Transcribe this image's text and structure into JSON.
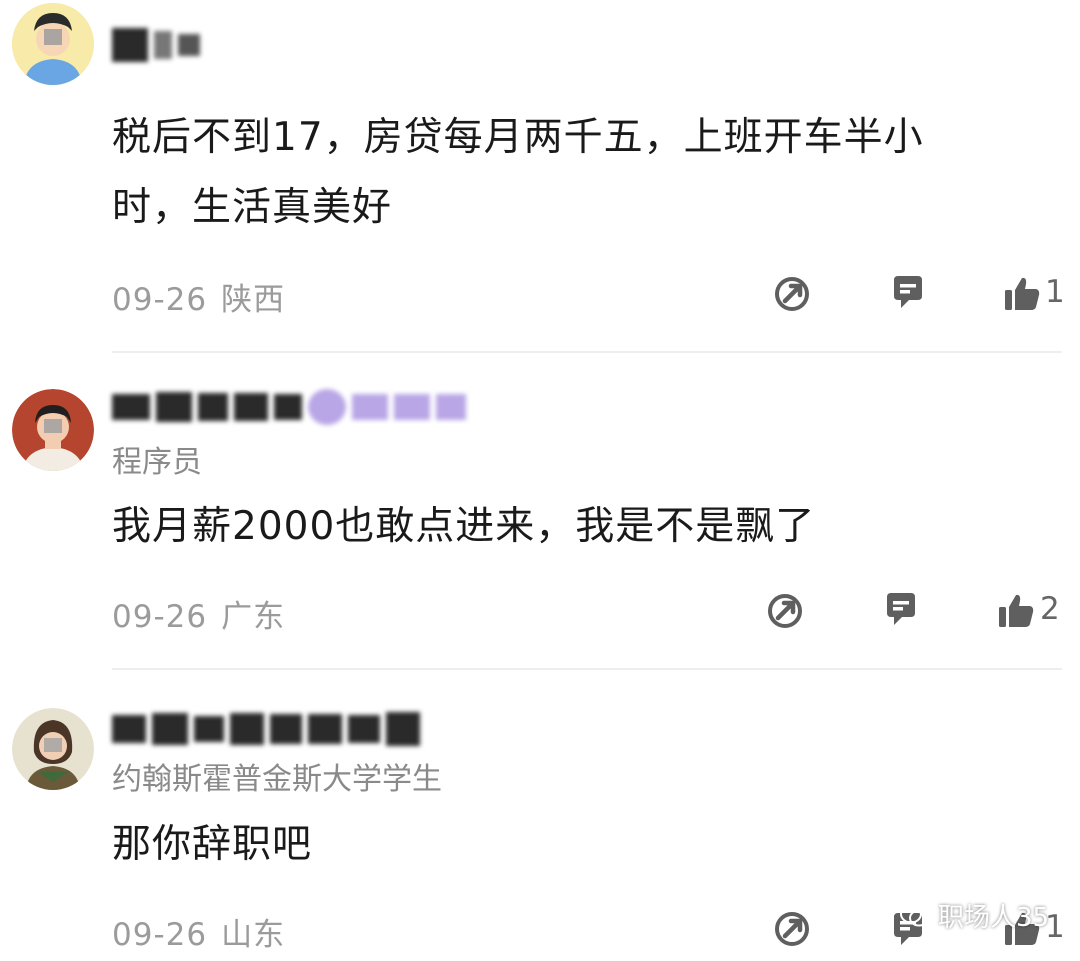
{
  "comments": [
    {
      "title": "",
      "text_line1": "税后不到17，房贷每月两千五，上班开车半小",
      "text_line2": "时，生活真美好",
      "date": "09-26",
      "location": "陕西",
      "likes": "1"
    },
    {
      "title": "程序员",
      "text_line1": "我月薪2000也敢点进来，我是不是飘了",
      "text_line2": "",
      "date": "09-26",
      "location": "广东",
      "likes": "2"
    },
    {
      "title": "约翰斯霍普金斯大学学生",
      "text_line1": "那你辞职吧",
      "text_line2": "",
      "date": "09-26",
      "location": "山东",
      "likes": "1"
    }
  ],
  "watermark": {
    "text": "职场人35"
  },
  "icons": {
    "share": "share-icon",
    "reply": "comment-icon",
    "like": "thumbs-up-icon"
  },
  "colors": {
    "text": "#1a1a1a",
    "meta": "#9b9b9b",
    "icon": "#5f5f5f",
    "divider": "#eeeeee"
  }
}
